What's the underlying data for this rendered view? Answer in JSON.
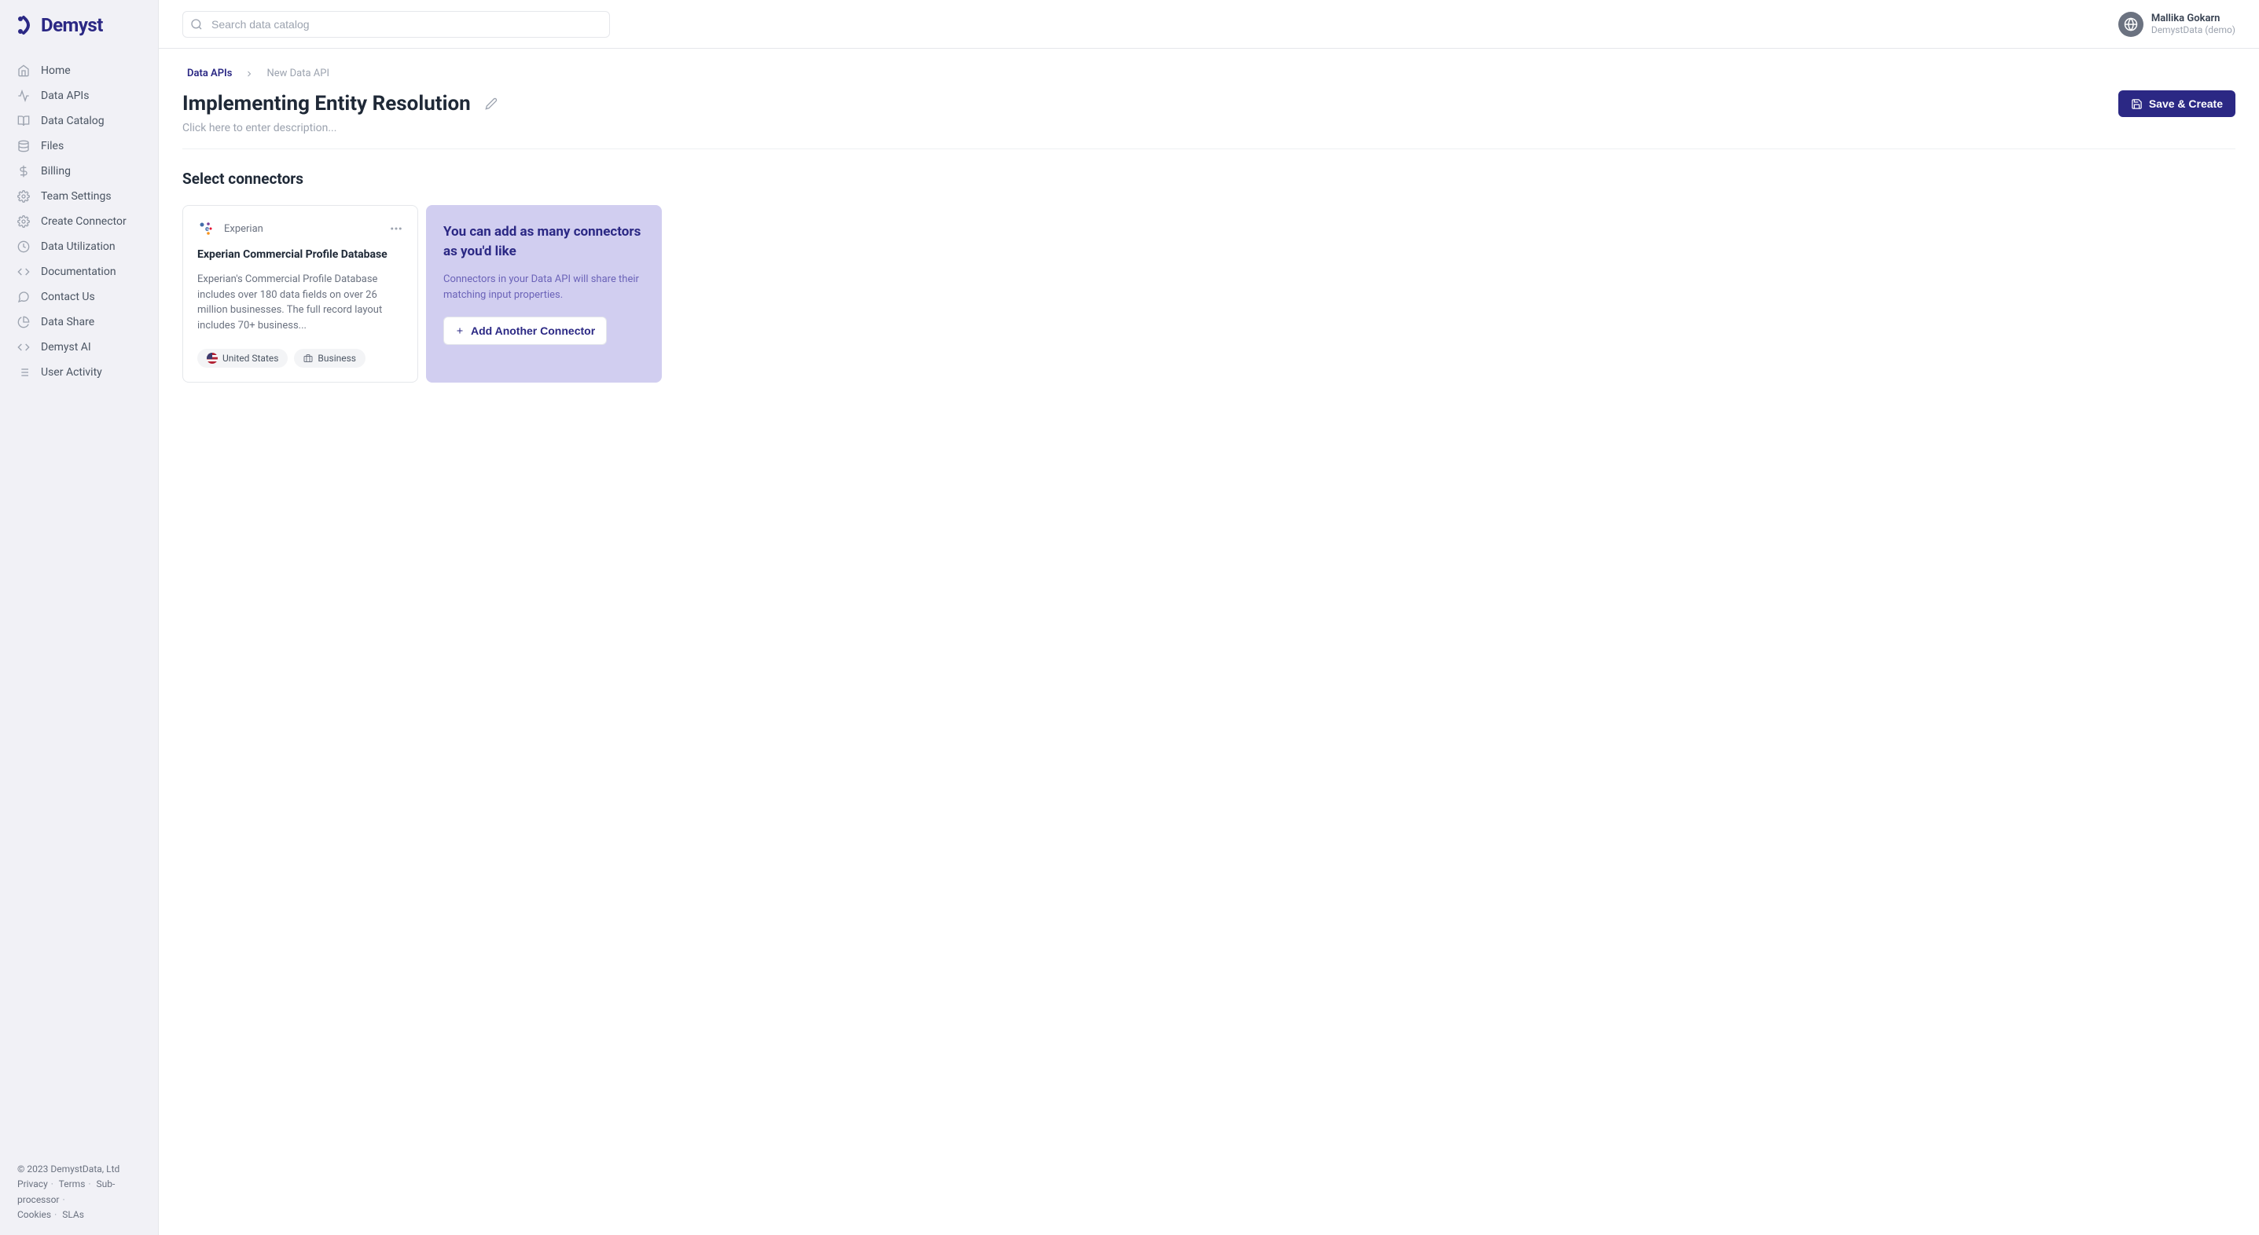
{
  "brand": "Demyst",
  "search": {
    "placeholder": "Search data catalog"
  },
  "user": {
    "name": "Mallika Gokarn",
    "org": "DemystData (demo)"
  },
  "sidebar": {
    "items": [
      {
        "label": "Home",
        "icon": "home-icon"
      },
      {
        "label": "Data APIs",
        "icon": "activity-icon"
      },
      {
        "label": "Data Catalog",
        "icon": "book-icon"
      },
      {
        "label": "Files",
        "icon": "database-icon"
      },
      {
        "label": "Billing",
        "icon": "dollar-icon"
      },
      {
        "label": "Team Settings",
        "icon": "gear-icon"
      },
      {
        "label": "Create Connector",
        "icon": "gear-icon"
      },
      {
        "label": "Data Utilization",
        "icon": "clock-icon"
      },
      {
        "label": "Documentation",
        "icon": "code-icon"
      },
      {
        "label": "Contact Us",
        "icon": "chat-icon"
      },
      {
        "label": "Data Share",
        "icon": "clock-icon"
      },
      {
        "label": "Demyst AI",
        "icon": "code-icon"
      },
      {
        "label": "User Activity",
        "icon": "list-icon"
      }
    ]
  },
  "footer": {
    "copyright": "© 2023 DemystData, Ltd",
    "links": [
      "Privacy",
      "Terms",
      "Sub-processor",
      "Cookies",
      "SLAs"
    ]
  },
  "breadcrumb": {
    "root": "Data APIs",
    "current": "New Data API"
  },
  "page": {
    "title": "Implementing Entity Resolution",
    "save_label": "Save & Create",
    "description_placeholder": "Click here to enter description...",
    "section_title": "Select connectors"
  },
  "connector": {
    "provider": "Experian",
    "title": "Experian Commercial Profile Database",
    "description": "Experian's Commercial Profile Database includes over 180 data fields on over 26 million businesses. The full record layout includes 70+ business...",
    "tag_country": "United States",
    "tag_type": "Business"
  },
  "info": {
    "title": "You can add as many connectors as you'd like",
    "description": "Connectors in your Data API will share their matching input properties.",
    "button": "Add Another Connector"
  }
}
